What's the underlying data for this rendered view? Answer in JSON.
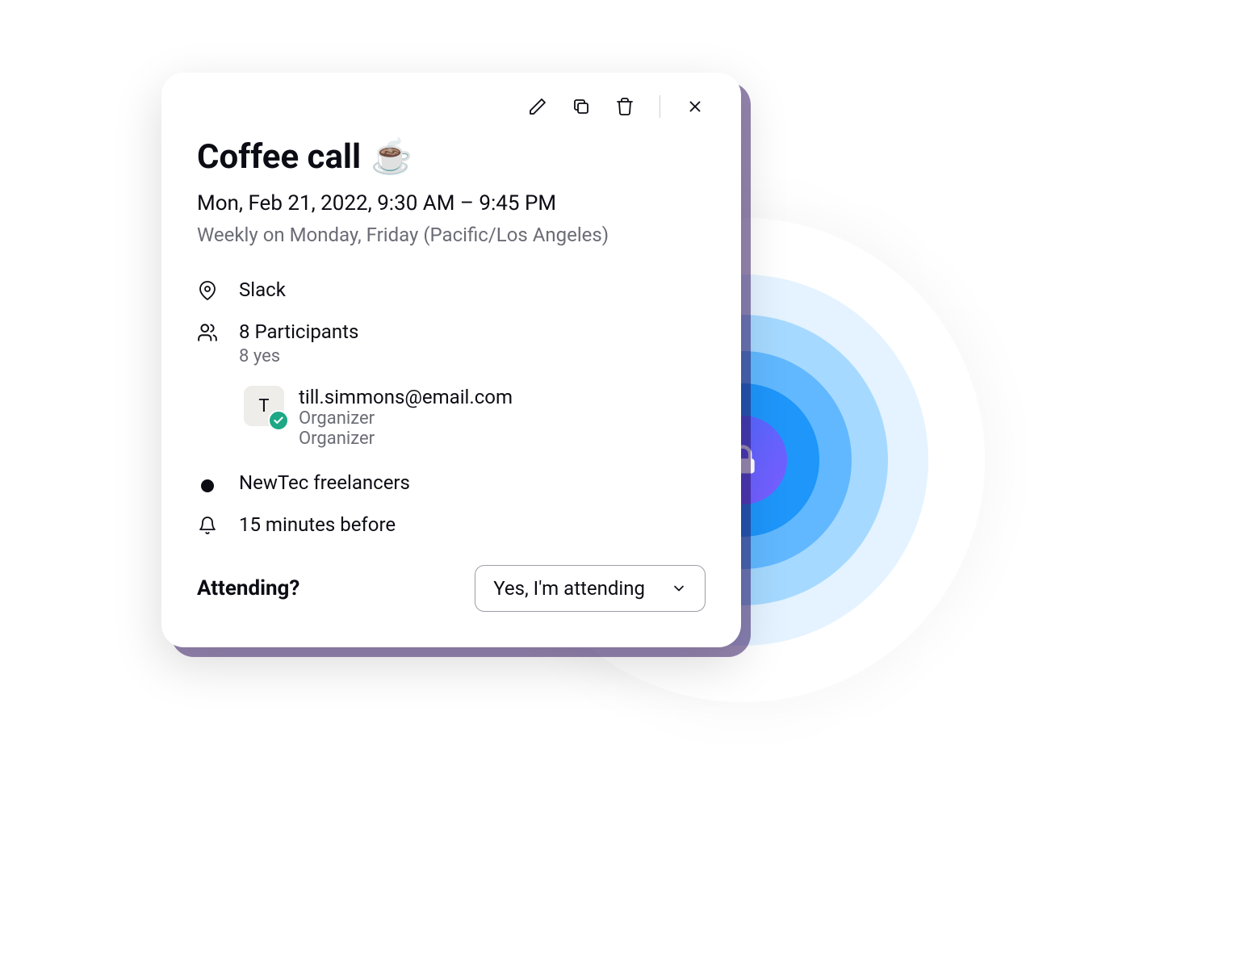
{
  "event": {
    "title": "Coffee call",
    "emoji": "☕",
    "datetime": "Mon, Feb 21, 2022, 9:30 AM – 9:45 PM",
    "recurrence": "Weekly on Monday, Friday (Pacific/Los Angeles)",
    "location": "Slack",
    "participants_count": "8 Participants",
    "participants_yes": "8 yes",
    "organizer": {
      "initial": "T",
      "email": "till.simmons@email.com",
      "role1": "Organizer",
      "role2": "Organizer"
    },
    "calendar": "NewTec freelancers",
    "reminder": "15 minutes before"
  },
  "attending": {
    "label": "Attending?",
    "value": "Yes, I'm attending"
  }
}
